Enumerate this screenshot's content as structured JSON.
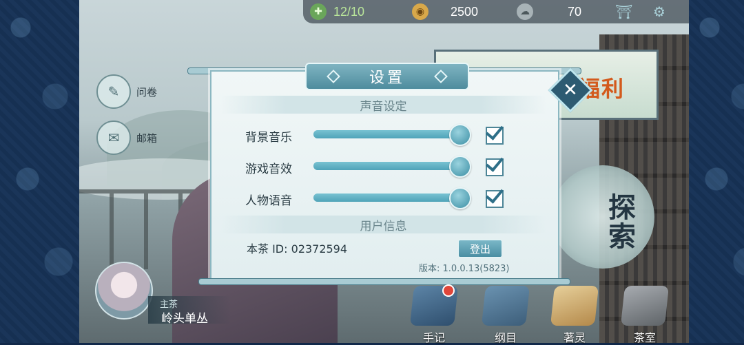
{
  "topbar": {
    "stamina": {
      "icon": "leaf-plus-icon",
      "current": "12",
      "max": "10",
      "display": "12/10"
    },
    "coins": {
      "icon": "coin-plus-icon",
      "value": "2500"
    },
    "cloud": {
      "icon": "cloud-icon",
      "value": "70"
    },
    "shop_icon": "shop-icon",
    "settings_icon": "gear-icon"
  },
  "side_buttons": {
    "survey": {
      "label": "问卷",
      "icon": "survey-icon"
    },
    "mailbox": {
      "label": "邮箱",
      "icon": "mail-icon"
    }
  },
  "banner": {
    "text": "戏福利"
  },
  "explore": {
    "text": "探索"
  },
  "dialog": {
    "title": "设置",
    "sound_section": "声音设定",
    "rows": [
      {
        "label": "背景音乐",
        "level": 1.0,
        "checked": true
      },
      {
        "label": "游戏音效",
        "level": 1.0,
        "checked": true
      },
      {
        "label": "人物语音",
        "level": 1.0,
        "checked": true
      }
    ],
    "user_section": "用户信息",
    "uid_label": "本茶 ID: 02372594",
    "logout_label": "登出",
    "version_text": "版本: 1.0.0.13(5823)",
    "close_icon": "close-icon"
  },
  "character": {
    "role": "主茶",
    "name": "岭头单丛"
  },
  "bottom_nav": [
    {
      "label": "手记",
      "icon": "notebook-icon",
      "has_badge": true
    },
    {
      "label": "纲目",
      "icon": "book-icon",
      "has_badge": false
    },
    {
      "label": "著灵",
      "icon": "scroll-icon",
      "has_badge": false
    },
    {
      "label": "茶室",
      "icon": "teahouse-icon",
      "has_badge": false
    }
  ],
  "colors": {
    "accent": "#4e8c9e",
    "panel_bg": "#eaf3f4",
    "badge": "#e0463a"
  }
}
